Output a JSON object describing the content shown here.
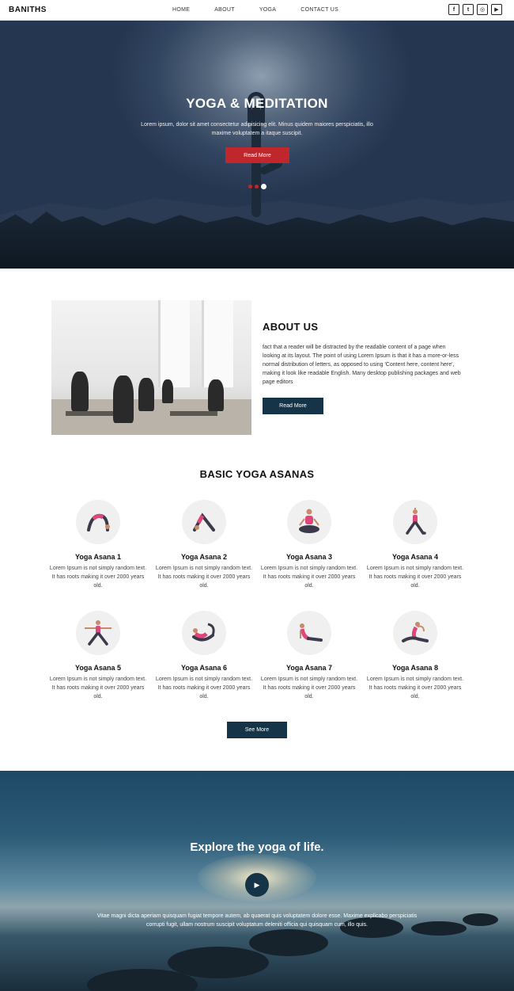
{
  "nav": {
    "brand": "BANITHS",
    "items": [
      "HOME",
      "ABOUT",
      "YOGA",
      "CONTACT US"
    ],
    "socials": [
      "facebook-icon",
      "twitter-icon",
      "instagram-icon",
      "youtube-icon"
    ]
  },
  "hero": {
    "title": "YOGA & MEDITATION",
    "text": "Lorem ipsum, dolor sit amet consectetur adipisicing elit. Minus quidem maiores perspiciatis, illo maxime voluptatem a itaque suscipit.",
    "button": "Read More",
    "slides": 3,
    "active_slide": 3
  },
  "about": {
    "title": "ABOUT US",
    "text": "fact that a reader will be distracted by the readable content of a page when looking at its layout. The point of using Lorem Ipsum is that it has a more-or-less normal distribution of letters, as opposed to using 'Content here, content here', making it look like readable English. Many desktop publishing packages and web page editors",
    "button": "Read More"
  },
  "asanas": {
    "title": "BASIC YOGA ASANAS",
    "items": [
      {
        "name": "Yoga Asana 1",
        "text": "Lorem Ipsum is not simply random text. It has roots making it over 2000 years old."
      },
      {
        "name": "Yoga Asana 2",
        "text": "Lorem Ipsum is not simply random text. It has roots making it over 2000 years old."
      },
      {
        "name": "Yoga Asana 3",
        "text": "Lorem Ipsum is not simply random text. It has roots making it over 2000 years old."
      },
      {
        "name": "Yoga Asana 4",
        "text": "Lorem Ipsum is not simply random text. It has roots making it over 2000 years old."
      },
      {
        "name": "Yoga Asana 5",
        "text": "Lorem Ipsum is not simply random text. It has roots making it over 2000 years old."
      },
      {
        "name": "Yoga Asana 6",
        "text": "Lorem Ipsum is not simply random text. It has roots making it over 2000 years old."
      },
      {
        "name": "Yoga Asana 7",
        "text": "Lorem Ipsum is not simply random text. It has roots making it over 2000 years old."
      },
      {
        "name": "Yoga Asana 8",
        "text": "Lorem Ipsum is not simply random text. It has roots making it over 2000 years old."
      }
    ],
    "button": "See More"
  },
  "explore": {
    "title": "Explore the yoga of life.",
    "text": "Vitae magni dicta aperiam quisquam fugiat tempore autem, ab quaerat quis voluptatem dolore esse. Maxime explicabo perspiciatis corrupti fugit, ullam nostrum suscipit voluptatum deleniti officia qui quisquam cum, illo quis."
  },
  "colors": {
    "accent": "#c0272d",
    "dark_button": "#163447",
    "pose_pink": "#e0457b"
  }
}
